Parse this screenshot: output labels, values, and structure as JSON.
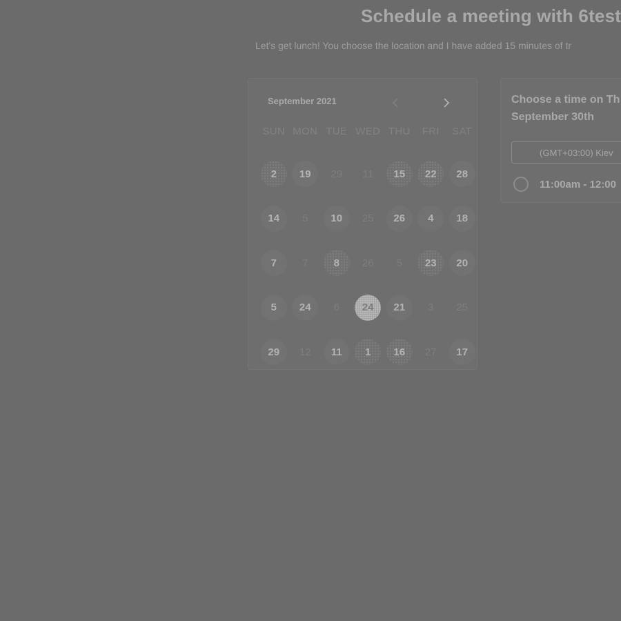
{
  "header": {
    "title": "Schedule a meeting with 6test",
    "description": "Let's get lunch! You choose the location and I have added 15 minutes of tr"
  },
  "calendar": {
    "month_label": "September 2021",
    "prev_icon": "chevron-left-icon",
    "next_icon": "chevron-right-icon",
    "weekdays": [
      "SUN",
      "MON",
      "TUE",
      "WED",
      "THU",
      "FRI",
      "SAT"
    ],
    "days": [
      {
        "label": "2",
        "state": "speckle"
      },
      {
        "label": "19",
        "state": "available"
      },
      {
        "label": "29",
        "state": "dim"
      },
      {
        "label": "11",
        "state": "dim"
      },
      {
        "label": "15",
        "state": "speckle"
      },
      {
        "label": "22",
        "state": "speckle"
      },
      {
        "label": "28",
        "state": "available"
      },
      {
        "label": "14",
        "state": "available"
      },
      {
        "label": "5",
        "state": "dim"
      },
      {
        "label": "10",
        "state": "available"
      },
      {
        "label": "25",
        "state": "dim"
      },
      {
        "label": "26",
        "state": "available"
      },
      {
        "label": "4",
        "state": "available"
      },
      {
        "label": "18",
        "state": "available"
      },
      {
        "label": "7",
        "state": "available"
      },
      {
        "label": "7",
        "state": "dim"
      },
      {
        "label": "8",
        "state": "speckle"
      },
      {
        "label": "26",
        "state": "dim"
      },
      {
        "label": "5",
        "state": "dim"
      },
      {
        "label": "23",
        "state": "speckle"
      },
      {
        "label": "20",
        "state": "available"
      },
      {
        "label": "5",
        "state": "available"
      },
      {
        "label": "24",
        "state": "available"
      },
      {
        "label": "6",
        "state": "dim"
      },
      {
        "label": "24",
        "state": "selected"
      },
      {
        "label": "21",
        "state": "available"
      },
      {
        "label": "3",
        "state": "dim"
      },
      {
        "label": "25",
        "state": "dim"
      },
      {
        "label": "29",
        "state": "available"
      },
      {
        "label": "12",
        "state": "dim"
      },
      {
        "label": "11",
        "state": "available"
      },
      {
        "label": "1",
        "state": "speckle"
      },
      {
        "label": "16",
        "state": "speckle"
      },
      {
        "label": "27",
        "state": "dim"
      },
      {
        "label": "17",
        "state": "available"
      }
    ]
  },
  "times": {
    "heading_line1": "Choose a time on Th",
    "heading_line2": "September 30th",
    "timezone": "(GMT+03:00) Kiev",
    "slots": [
      {
        "label": "11:00am - 12:00"
      }
    ]
  }
}
